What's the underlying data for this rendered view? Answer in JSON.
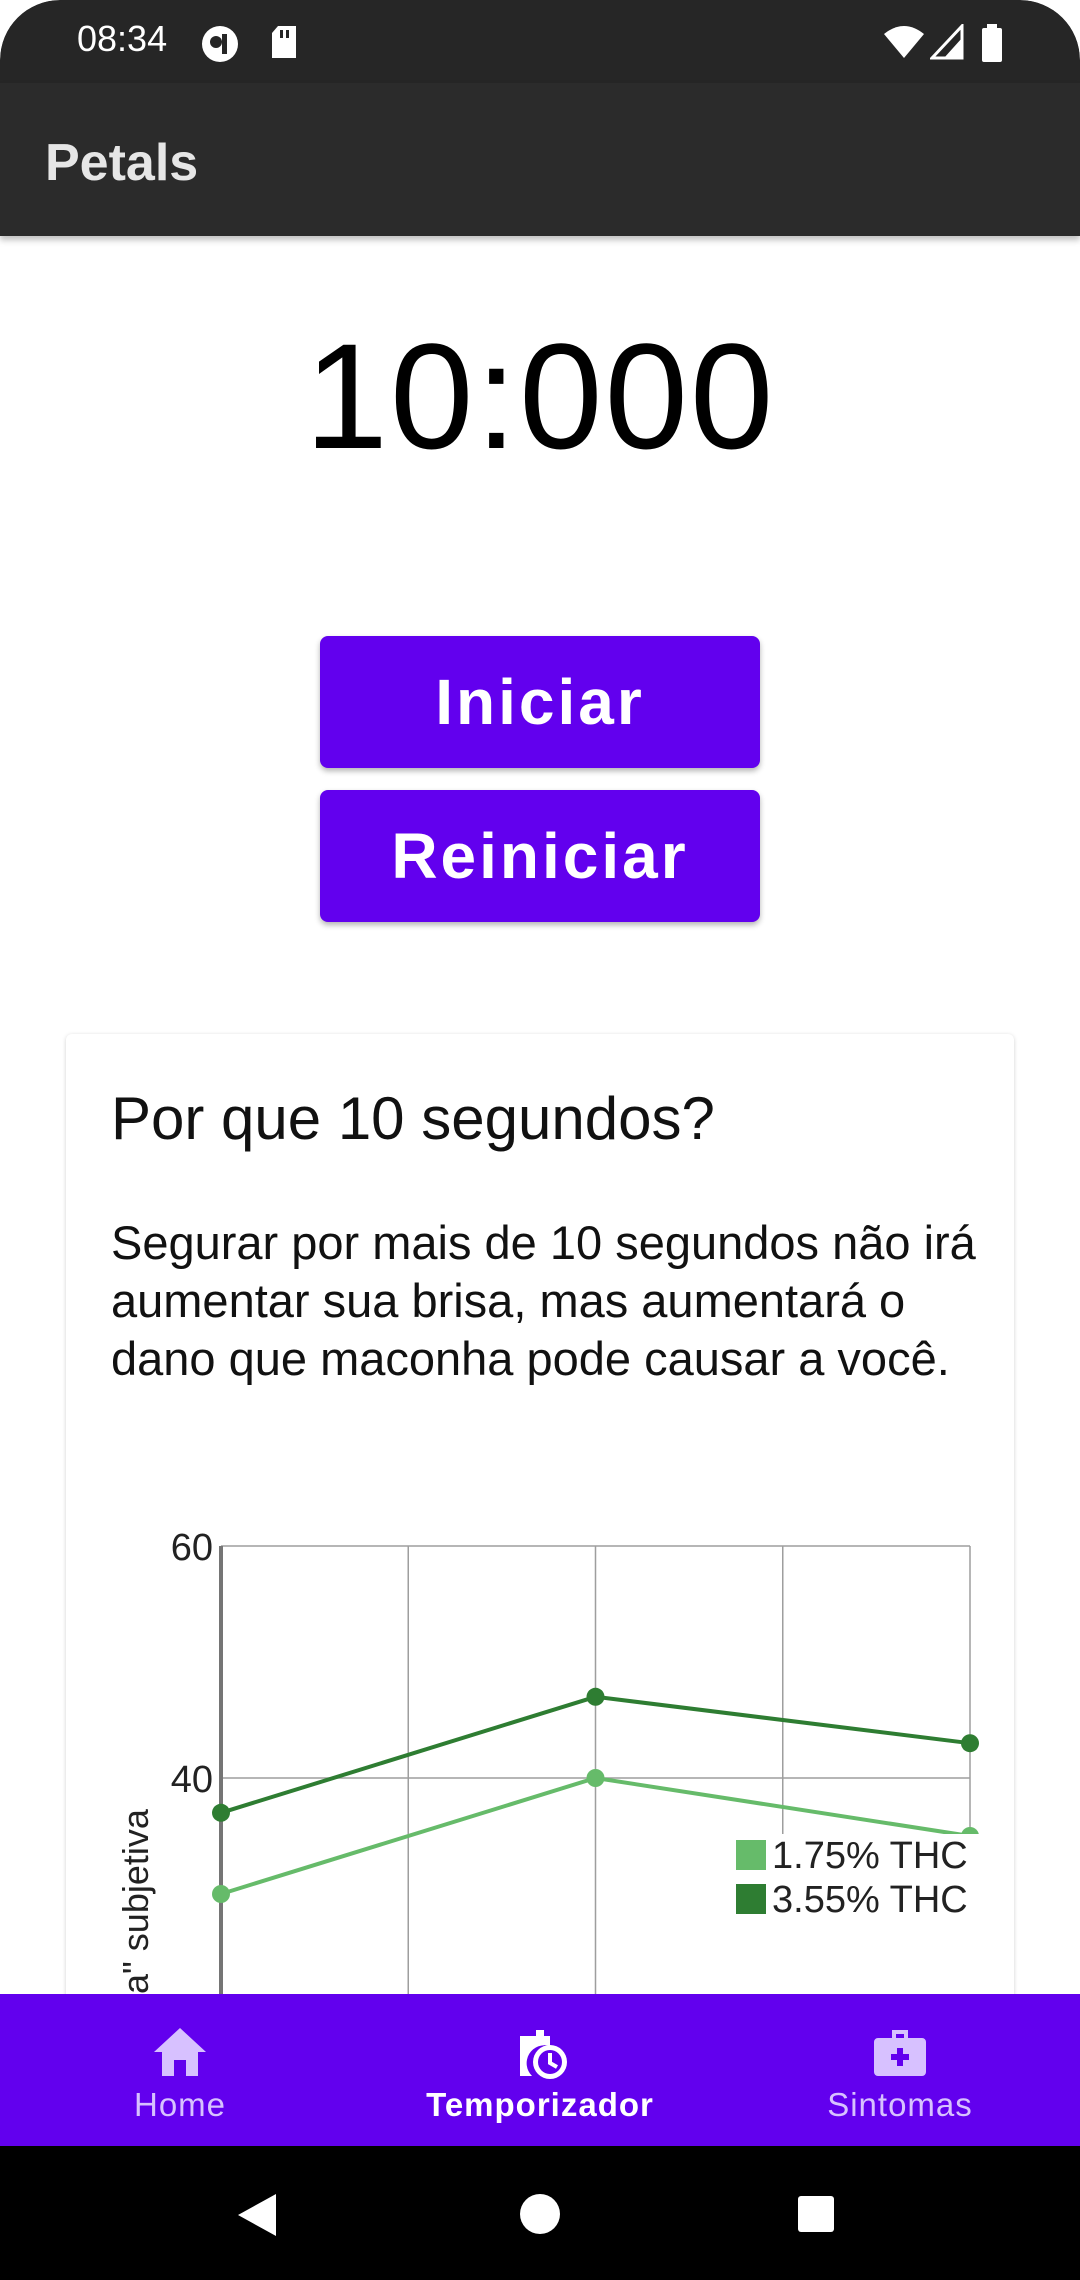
{
  "status_bar": {
    "time": "08:34"
  },
  "app": {
    "title": "Petals"
  },
  "timer": {
    "display": "10:000"
  },
  "buttons": {
    "start": "Iniciar",
    "restart": "Reiniciar"
  },
  "card": {
    "title": "Por que 10 segundos?",
    "text": "Segurar por mais de 10 segundos não irá aumentar sua brisa, mas aumentará o dano que maconha pode causar a você."
  },
  "chart_data": {
    "type": "line",
    "x": [
      0,
      1,
      2,
      3,
      4
    ],
    "ylabel": "a\" subjetiva",
    "ylim": [
      20,
      60
    ],
    "yticks": [
      40,
      60
    ],
    "grid": true,
    "legend_position": "bottom-right",
    "series": [
      {
        "name": "1.75% THC",
        "color": "#66bb6a",
        "points": [
          [
            0,
            30
          ],
          [
            2,
            40
          ],
          [
            4,
            35
          ]
        ]
      },
      {
        "name": "3.55% THC",
        "color": "#2e7d32",
        "points": [
          [
            0,
            37
          ],
          [
            2,
            47
          ],
          [
            4,
            43
          ]
        ]
      }
    ]
  },
  "bottom_nav": {
    "items": [
      {
        "label": "Home",
        "icon": "home-icon"
      },
      {
        "label": "Temporizador",
        "icon": "timer-icon",
        "active": true
      },
      {
        "label": "Sintomas",
        "icon": "medical-kit-icon"
      }
    ]
  },
  "system_nav": {
    "icons": [
      "back-icon",
      "home-circle-icon",
      "recents-icon"
    ]
  }
}
